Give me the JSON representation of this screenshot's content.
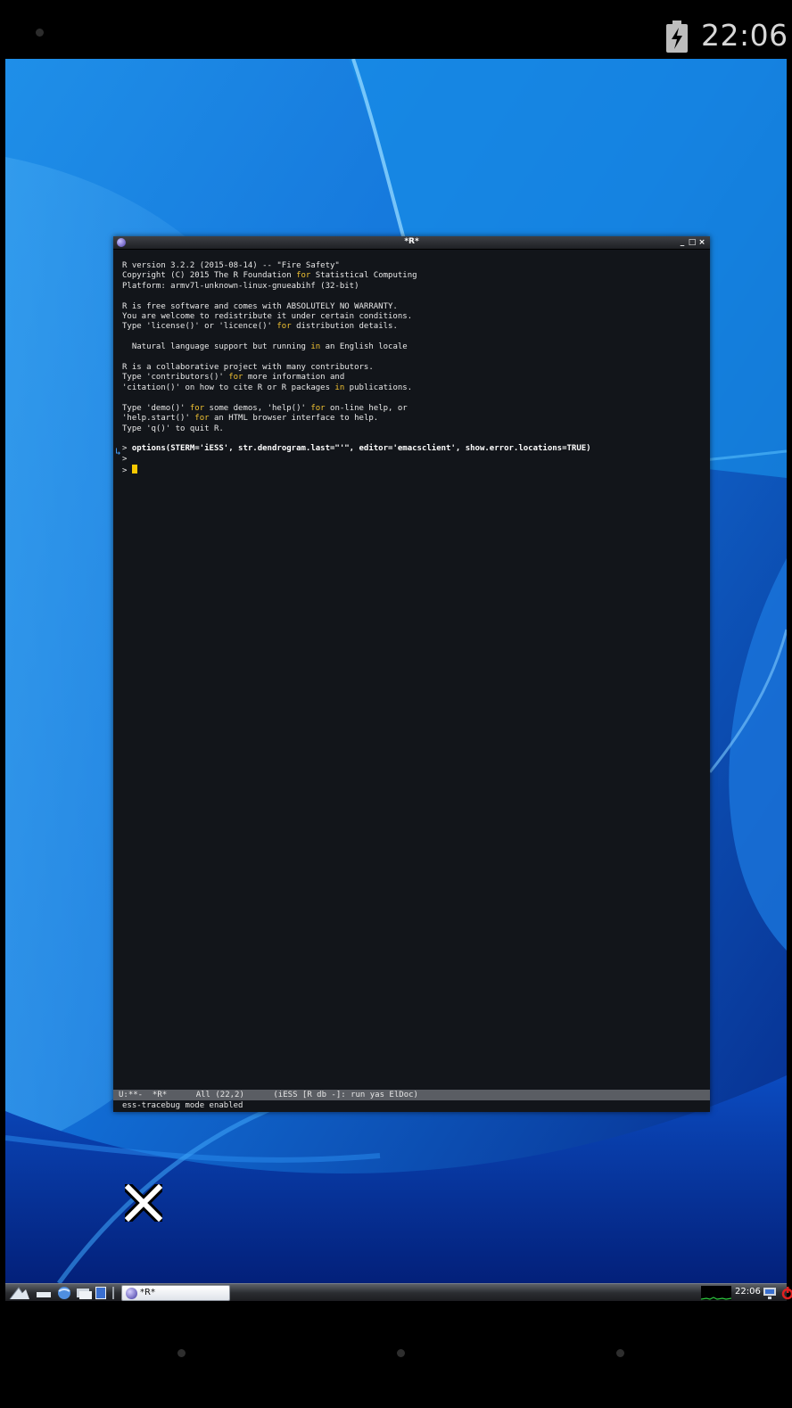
{
  "android_status": {
    "time": "22:06",
    "battery_icon": "battery-charging-icon"
  },
  "window": {
    "title": "*R*",
    "controls": {
      "minimize": "_",
      "maximize": "□",
      "close": "×"
    }
  },
  "buffer": {
    "lines": [
      {
        "segments": [
          {
            "t": "R version 3.2.2 (2015-08-14) -- \"Fire Safety\""
          }
        ]
      },
      {
        "segments": [
          {
            "t": "Copyright (C) 2015 The R Foundation "
          },
          {
            "t": "for",
            "kw": true
          },
          {
            "t": " Statistical Computing"
          }
        ]
      },
      {
        "segments": [
          {
            "t": "Platform: armv7l-unknown-linux-gnueabihf (32-bit)"
          }
        ]
      },
      {
        "segments": [
          {
            "t": ""
          }
        ]
      },
      {
        "segments": [
          {
            "t": "R is free software and comes with ABSOLUTELY NO WARRANTY."
          }
        ]
      },
      {
        "segments": [
          {
            "t": "You are welcome to redistribute it under certain conditions."
          }
        ]
      },
      {
        "segments": [
          {
            "t": "Type 'license()' or 'licence()' "
          },
          {
            "t": "for",
            "kw": true
          },
          {
            "t": " distribution details."
          }
        ]
      },
      {
        "segments": [
          {
            "t": ""
          }
        ]
      },
      {
        "segments": [
          {
            "t": "  Natural language support but running "
          },
          {
            "t": "in",
            "kw": true
          },
          {
            "t": " an English locale"
          }
        ]
      },
      {
        "segments": [
          {
            "t": ""
          }
        ]
      },
      {
        "segments": [
          {
            "t": "R is a collaborative project with many contributors."
          }
        ]
      },
      {
        "segments": [
          {
            "t": "Type 'contributors()' "
          },
          {
            "t": "for",
            "kw": true
          },
          {
            "t": " more information and"
          }
        ]
      },
      {
        "segments": [
          {
            "t": "'citation()' on how to cite R or R packages "
          },
          {
            "t": "in",
            "kw": true
          },
          {
            "t": " publications."
          }
        ]
      },
      {
        "segments": [
          {
            "t": ""
          }
        ]
      },
      {
        "segments": [
          {
            "t": "Type 'demo()' "
          },
          {
            "t": "for",
            "kw": true
          },
          {
            "t": " some demos, 'help()' "
          },
          {
            "t": "for",
            "kw": true
          },
          {
            "t": " on-line help, or"
          }
        ]
      },
      {
        "segments": [
          {
            "t": "'help.start()' "
          },
          {
            "t": "for",
            "kw": true
          },
          {
            "t": " an HTML browser interface to help."
          }
        ]
      },
      {
        "segments": [
          {
            "t": "Type 'q()' to quit R."
          }
        ]
      },
      {
        "segments": [
          {
            "t": ""
          }
        ]
      },
      {
        "segments": [
          {
            "t": "> "
          },
          {
            "t": "options(STERM='iESS', str.dendrogram.last=\"'\", editor='emacsclient', show.error.locations=TRUE)",
            "cmd": true
          }
        ]
      },
      {
        "segments": [
          {
            "t": ">"
          }
        ]
      },
      {
        "segments": [
          {
            "t": "> "
          }
        ],
        "cursor": true
      }
    ]
  },
  "modeline": "U:**-  *R*      All (22,2)      (iESS [R db -]: run yas ElDoc)",
  "echo_area": "ess-tracebug mode enabled",
  "taskbar": {
    "task_label": "*R*",
    "clock": "22:06"
  }
}
